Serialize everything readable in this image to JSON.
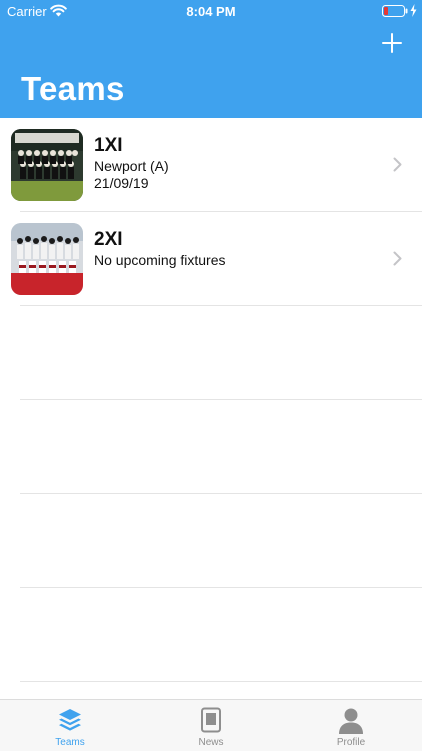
{
  "status_bar": {
    "carrier": "Carrier",
    "time": "8:04 PM"
  },
  "header": {
    "title": "Teams",
    "add_icon": "plus-icon"
  },
  "teams": [
    {
      "name": "1XI",
      "line1": "Newport (A)",
      "line2": "21/09/19"
    },
    {
      "name": "2XI",
      "line1": "No upcoming fixtures",
      "line2": ""
    }
  ],
  "tab_bar": {
    "tabs": [
      {
        "label": "Teams",
        "icon": "layers-icon",
        "active": true
      },
      {
        "label": "News",
        "icon": "news-icon",
        "active": false
      },
      {
        "label": "Profile",
        "icon": "person-icon",
        "active": false
      }
    ]
  },
  "colors": {
    "accent": "#3fa2ee",
    "battery_low": "#e53935"
  }
}
